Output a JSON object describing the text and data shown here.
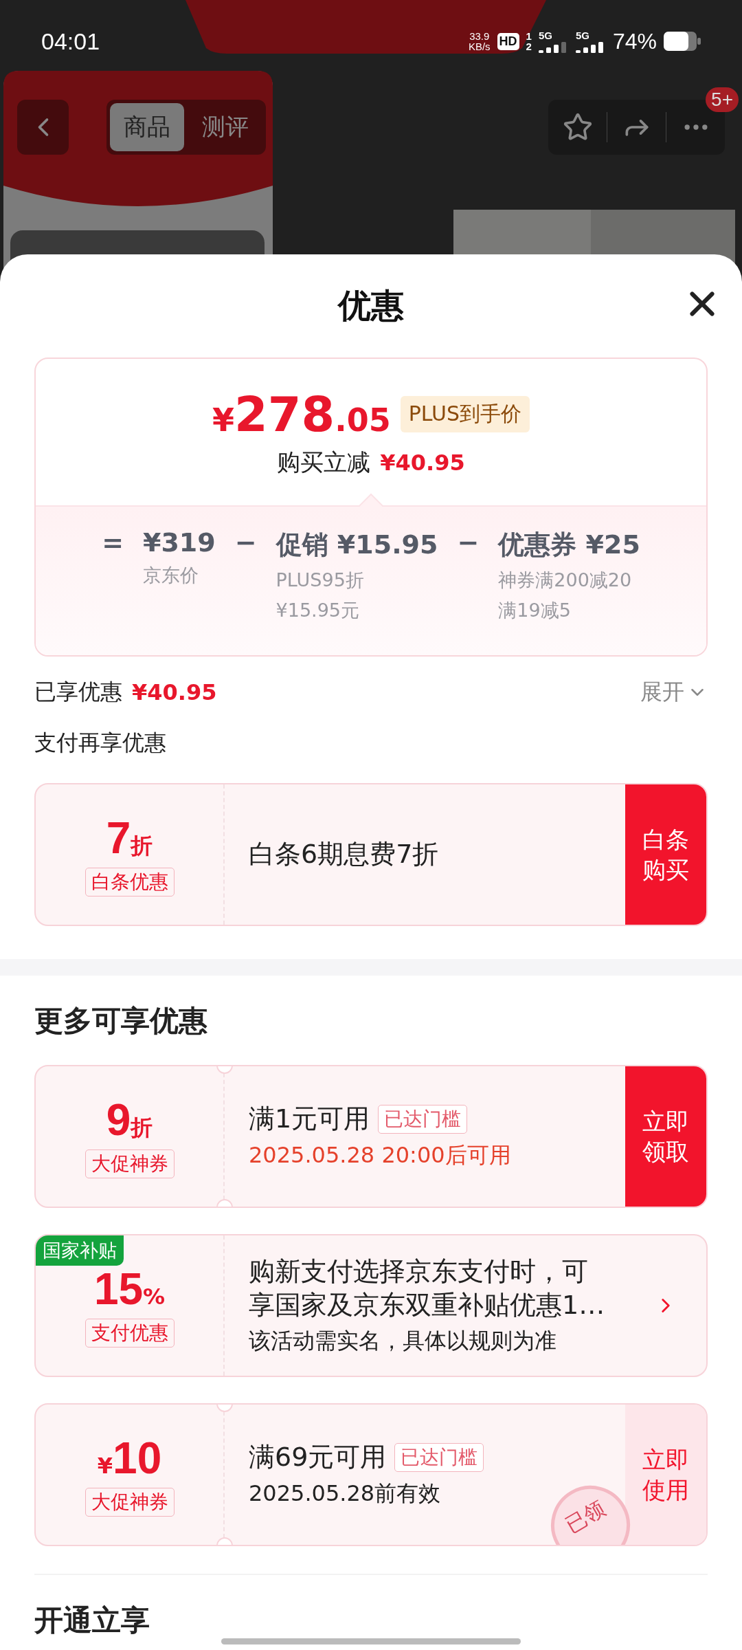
{
  "status_bar": {
    "time": "04:01",
    "speed": "33.9",
    "speed_unit": "KB/s",
    "hd": "HD",
    "slots": [
      "1",
      "2"
    ],
    "networks": [
      "5G",
      "5G"
    ],
    "battery": "74%"
  },
  "nav": {
    "tabs": [
      {
        "label": "商品",
        "selected": true
      },
      {
        "label": "测评",
        "selected": false
      }
    ],
    "badge": "5+"
  },
  "sheet": {
    "title": "优惠"
  },
  "price": {
    "currency": "¥",
    "integer": "278",
    "decimal": ".05",
    "tag": "PLUS到手价",
    "cut_label": "购买立减",
    "cut_amount": "¥40.95",
    "breakdown": [
      {
        "operator": "=",
        "amount": "¥319",
        "notes": [
          "京东价"
        ]
      },
      {
        "operator": "−",
        "amount": "促销 ¥15.95",
        "notes": [
          "PLUS95折",
          "¥15.95元"
        ]
      },
      {
        "operator": "−",
        "amount": "优惠券 ¥25",
        "notes": [
          "神券满200减20",
          "满19减5"
        ]
      }
    ]
  },
  "saved": {
    "label": "已享优惠",
    "amount": "¥40.95",
    "toggle": "展开"
  },
  "pay_section": {
    "title": "支付再享优惠",
    "coupons": [
      {
        "value": "7",
        "suffix": "折",
        "tag": "白条优惠",
        "title": "白条6期息费7折",
        "kind": "plain",
        "action": {
          "kind": "solid",
          "label": "白条购买"
        }
      }
    ]
  },
  "more_section": {
    "title": "更多可享优惠",
    "coupons": [
      {
        "value": "9",
        "suffix": "折",
        "tag": "大促神券",
        "title": "满1元可用",
        "badge": "已达门槛",
        "subtitle": "2025.05.28 20:00后可用",
        "highlighted": true,
        "kind": "ticket",
        "action": {
          "kind": "solid",
          "label": "立即领取"
        }
      },
      {
        "corner": "国家补贴",
        "value": "15",
        "suffix": "%",
        "tag": "支付优惠",
        "title": "购新支付选择京东支付时，可享国家及京东双重补贴优惠1…",
        "subtitle": "该活动需实名，具体以规则为准",
        "highlighted": false,
        "kind": "plain",
        "action": {
          "kind": "arrow"
        }
      },
      {
        "prefix": "¥",
        "value": "10",
        "tag": "大促神券",
        "title": "满69元可用",
        "badge": "已达门槛",
        "subtitle": "2025.05.28前有效",
        "highlighted": false,
        "kind": "ticket",
        "stamp": "已领",
        "action": {
          "kind": "soft",
          "label": "立即使用"
        }
      }
    ]
  },
  "next_section": {
    "title": "开通立享"
  }
}
